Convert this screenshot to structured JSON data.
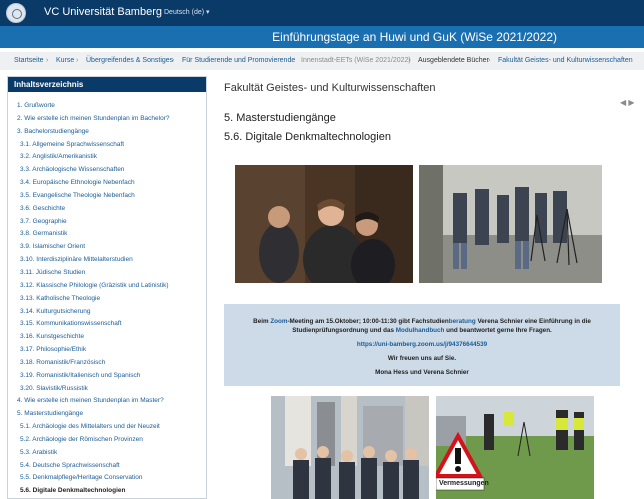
{
  "header": {
    "site_name": "VC Universität Bamberg",
    "language": "Deutsch (de) ▾",
    "course_title": "Einführungstage an Huwi und GuK (WiSe 2021/2022)"
  },
  "breadcrumb": {
    "items": [
      "Startseite",
      "Kurse",
      "Übergreifendes & Sonstiges",
      "Für Studierende und Promovierende",
      "Innenstadt-EETs (WiSe 2021/2022)",
      "Ausgeblendete Bücher",
      "Fakultät Geistes- und Kulturwissenschaften"
    ],
    "separator": "›"
  },
  "toc": {
    "title": "Inhaltsverzeichnis",
    "items": [
      "1. Grußworte",
      "2. Wie erstelle ich meinen Stundenplan im Bachelor?",
      "3. Bachelorstudiengänge",
      "3.1. Allgemeine Sprachwissenschaft",
      "3.2. Anglistik/Amerikanistik",
      "3.3. Archäologische Wissenschaften",
      "3.4. Europäische Ethnologie Nebenfach",
      "3.5. Evangelische Theologie Nebenfach",
      "3.6. Geschichte",
      "3.7. Geographie",
      "3.8. Germanistik",
      "3.9. Islamischer Orient",
      "3.10. Interdisziplinäre Mittelalterstudien",
      "3.11. Jüdische Studien",
      "3.12. Klassische Philologie (Gräzistik und Latinistik)",
      "3.13. Katholische Theologie",
      "3.14. Kultur­gutsicherung",
      "3.15. Kommunikationswissenschaft",
      "3.16. Kunstgeschichte",
      "3.17. Philosophie/Ethik",
      "3.18. Romanistik/Französisch",
      "3.19. Romanistik/Italienisch und Spanisch",
      "3.20. Slavistik/Russistik",
      "4. Wie erstelle ich meinen Stundenplan im Master?",
      "5. Masterstudiengänge",
      "5.1. Archäologie des Mittelalters und der Neuzeit",
      "5.2. Archäologie der Römischen Provinzen",
      "5.3. Arabistik",
      "5.4. Deutsche Sprachwissenschaft",
      "5.5. Denkmalpflege/Heritage Conservation",
      "5.6. Digitale Denkmaltechnologien"
    ],
    "active_index": 30
  },
  "main": {
    "faculty": "Fakultät Geistes- und Kulturwissenschaften",
    "nav_prev": "◀",
    "nav_next": "▶",
    "section": "5. Masterstudiengänge",
    "subsection": "5.6. Digitale Denkmaltechnologien",
    "sign_text": "Vermessungen"
  },
  "info": {
    "line1_a": "Beim ",
    "line1_zoom": "Zoom",
    "line1_b": "-Meeting am 15.Oktober; 10:00-11:30 gibt Fachstudien",
    "line1_beratung": "beratung",
    "line1_c": " Verena Schnier eine Einführung in die",
    "line2_a": "Studienprüfungsordnung und das ",
    "line2_link": "Modulhandbuch",
    "line2_b": " und beantwortet gerne Ihre Fragen.",
    "zoom_link": "https://uni-bamberg.zoom.us/j/94376644539",
    "greeting": "Wir freuen uns auf Sie.",
    "signature": "Mona Hess und Verena Schnier"
  },
  "colors": {
    "header": "#0a3a68",
    "course_bar": "#1a6fb0",
    "link": "#1a5c97",
    "info_bg": "#cddbe8"
  }
}
